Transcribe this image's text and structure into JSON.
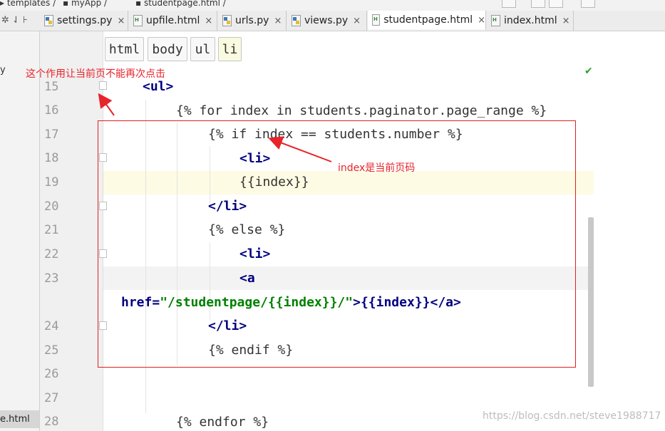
{
  "breadcrumb_top": [
    "templates",
    "myApp",
    "studentpage.html"
  ],
  "tabs": [
    {
      "label": "settings.py",
      "icon": "python-file-icon"
    },
    {
      "label": "upfile.html",
      "icon": "html-file-icon"
    },
    {
      "label": "urls.py",
      "icon": "python-file-icon"
    },
    {
      "label": "views.py",
      "icon": "python-file-icon"
    },
    {
      "label": "studentpage.html",
      "icon": "html-file-icon",
      "active": true
    },
    {
      "label": "index.html",
      "icon": "html-file-icon"
    }
  ],
  "tab_close": "×",
  "toolbar_icons": "✲ ⇃ ⊦",
  "element_breadcrumb": [
    "html",
    "body",
    "ul",
    "li"
  ],
  "left_panel": {
    "fragment_top": "y",
    "selected_file": "e.html"
  },
  "line_numbers": [
    "15",
    "16",
    "17",
    "18",
    "19",
    "20",
    "21",
    "22",
    "23",
    "24",
    "25",
    "26",
    "27",
    "28"
  ],
  "code": {
    "l15": "<ul>",
    "l16": "{% for index in students.paginator.page_range %}",
    "l17": "{% if index == students.number %}",
    "l18": "<li>",
    "l19": "{{index}}",
    "l20": "</li>",
    "l21": "{% else %}",
    "l22": "<li>",
    "l23": "<a",
    "l23b_attr": "href=",
    "l23b_value": "\"/studentpage/{{index}}/\"",
    "l23b_rest": ">{{index}}</a>",
    "l24": "</li>",
    "l25": "{% endif %}",
    "l28": "{% endfor %}"
  },
  "annotations": {
    "top_note": "这个作用让当前页不能再次点击",
    "index_note": "index是当前页码"
  },
  "watermark": "https://blog.csdn.net/steve1988717",
  "colors": {
    "annotation": "#e8232a",
    "tag": "#000080",
    "string": "#008000"
  }
}
